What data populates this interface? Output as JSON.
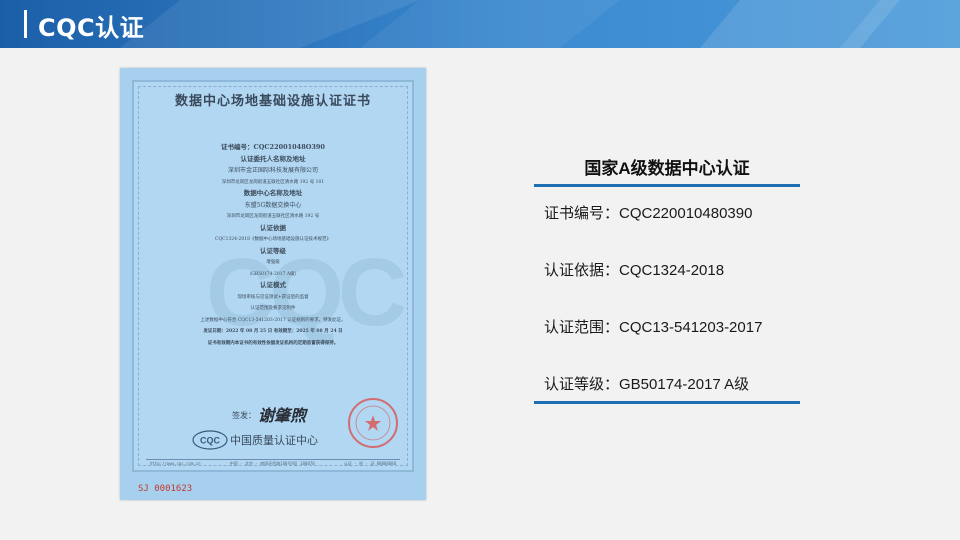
{
  "header": {
    "title": "CQC认证"
  },
  "certificate": {
    "title": "数据中心场地基础设施认证证书",
    "lines": [
      "证书编号：CQC22001048O390",
      "认证委托人名称及地址",
      "深圳市金正国际科技发展有限公司",
      "深圳市龙岗区龙岗街道五联社区清水路 192 号 101",
      "数据中心名称及地址",
      "东盟5G数据交换中心",
      "深圳市龙岗区龙岗街道五联社区清水路 192 号",
      "认证依据",
      "CQC1324-2018《数据中心场地基础设施认证技术规范》",
      "认证等级",
      "增强级",
      "（GB50174-2017 A级）",
      "认证模式",
      "现场审核与见证测试+获证后的监督",
      "认证范围及要求见附件",
      "上述数据中心符合 CQC13-541203-2017 认证规则的要求，特发此证。",
      "发证日期：2022 年 08 月 25 日      有效期至：2025 年 08 月 24 日",
      "证书有效期内本证书的有效性依据发证机构的定期监督获得保持。"
    ],
    "watermark": "CQC",
    "sign_label": "签发：",
    "signature": "谢肇煦",
    "org_logo": "CQC",
    "org_name": "中国质量认证中心",
    "footer_left": "http://www.cqc.com.cn",
    "footer_mid": "中国 · 北京 · 南四环西路188号9区   100070",
    "footer_right": "认证 · 检 · 证 88888888",
    "serial": "SJ 0001623",
    "seal_text": "QUALITY CERTIFICATION CENTER"
  },
  "info": {
    "title": "国家A级数据中心认证",
    "items": [
      "证书编号：CQC220010480390",
      "认证依据：CQC1324-2018",
      "认证范围：CQC13-541203-2017",
      "认证等级：GB50174-2017 A级"
    ]
  },
  "colors": {
    "header_dark": "#1b5fa8",
    "header_light": "#3f8fd3",
    "rule": "#1f6fb3",
    "seal": "#d9534f"
  }
}
